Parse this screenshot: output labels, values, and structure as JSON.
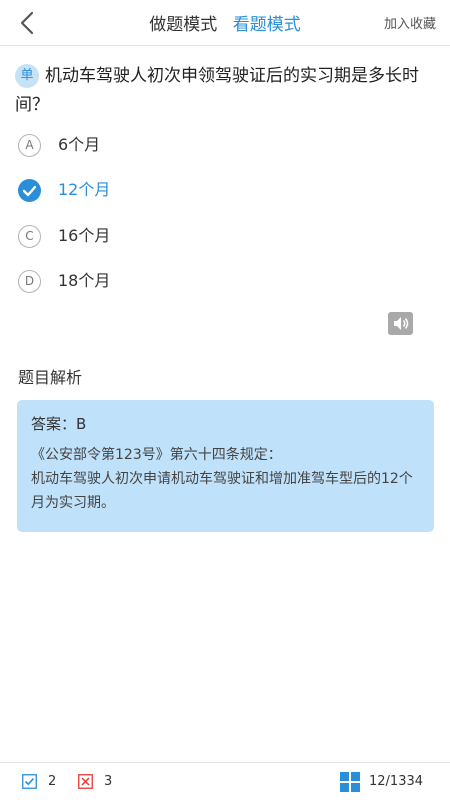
{
  "header": {
    "modes": [
      {
        "label": "做题模式",
        "active": false
      },
      {
        "label": "看题模式",
        "active": true
      }
    ],
    "favorite_label": "加入收藏"
  },
  "question": {
    "type_badge": "单",
    "text": "机动车驾驶人初次申领驾驶证后的实习期是多长时间？"
  },
  "options": [
    {
      "key": "A",
      "text": "6个月",
      "correct": false
    },
    {
      "key": "B",
      "text": "12个月",
      "correct": true
    },
    {
      "key": "C",
      "text": "16个月",
      "correct": false
    },
    {
      "key": "D",
      "text": "18个月",
      "correct": false
    }
  ],
  "analysis": {
    "title": "题目解析",
    "answer": "答案：B",
    "explanation_line1": "《公安部令第123号》第六十四条规定：",
    "explanation_line2": "机动车驾驶人初次申请机动车驾驶证和增加准驾车型后的12个月为实习期。"
  },
  "footer": {
    "correct_count": "2",
    "wrong_count": "3",
    "progress": "12/1334"
  },
  "colors": {
    "accent": "#2a8fd8",
    "answer_bg": "#bfe1fa",
    "wrong": "#e53935"
  }
}
